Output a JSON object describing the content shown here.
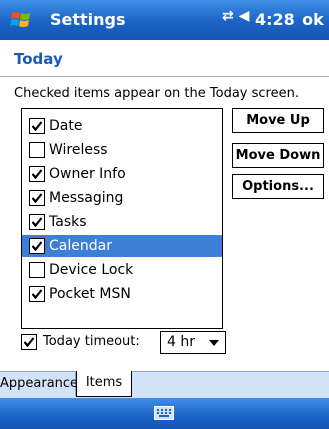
{
  "titlebar": {
    "title": "Settings",
    "status_icons": "⇄ ◀",
    "clock": "4:28",
    "ok_label": "ok"
  },
  "page": {
    "title": "Today",
    "description": "Checked items appear on the Today screen."
  },
  "items": [
    {
      "label": "Date",
      "checked": true,
      "selected": false
    },
    {
      "label": "Wireless",
      "checked": false,
      "selected": false
    },
    {
      "label": "Owner Info",
      "checked": true,
      "selected": false
    },
    {
      "label": "Messaging",
      "checked": true,
      "selected": false
    },
    {
      "label": "Tasks",
      "checked": true,
      "selected": false
    },
    {
      "label": "Calendar",
      "checked": true,
      "selected": true
    },
    {
      "label": "Device Lock",
      "checked": false,
      "selected": false
    },
    {
      "label": "Pocket MSN",
      "checked": true,
      "selected": false
    }
  ],
  "buttons": {
    "move_up": "Move Up",
    "move_down": "Move Down",
    "options": "Options..."
  },
  "timeout": {
    "checked": true,
    "label": "Today timeout:",
    "value": "4 hr"
  },
  "tabs": {
    "appearance": "Appearance",
    "items": "Items",
    "active": "Items"
  },
  "colors": {
    "accent": "#1b63c6",
    "selection": "#3d7fd6",
    "page_title": "#1a5bb6"
  }
}
